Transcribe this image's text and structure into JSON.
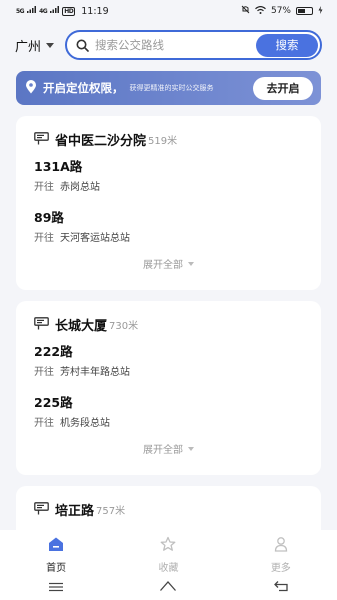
{
  "status_bar": {
    "signal1": "5G",
    "signal2": "4G",
    "hd": "HD",
    "time": "11:19",
    "battery_percent": "57%",
    "battery_level": 0.57
  },
  "search": {
    "city": "广州",
    "placeholder": "搜索公交路线",
    "button_label": "搜索"
  },
  "location_banner": {
    "title": "开启定位权限，",
    "subtitle": "获得更精准的实时公交服务",
    "button_label": "去开启"
  },
  "stops": [
    {
      "name": "省中医二沙分院",
      "distance": "519米",
      "routes": [
        {
          "name": "131A路",
          "prefix": "开往",
          "destination": "赤岗总站"
        },
        {
          "name": "89路",
          "prefix": "开往",
          "destination": "天河客运站总站"
        }
      ],
      "expand_label": "展开全部"
    },
    {
      "name": "长城大厦",
      "distance": "730米",
      "routes": [
        {
          "name": "222路",
          "prefix": "开往",
          "destination": "芳村丰年路总站"
        },
        {
          "name": "225路",
          "prefix": "开往",
          "destination": "机务段总站"
        }
      ],
      "expand_label": "展开全部"
    },
    {
      "name": "培正路",
      "distance": "757米",
      "routes": [],
      "expand_label": ""
    }
  ],
  "tabs": [
    {
      "label": "首页",
      "icon": "home-icon",
      "active": true
    },
    {
      "label": "收藏",
      "icon": "star-icon",
      "active": false
    },
    {
      "label": "更多",
      "icon": "person-icon",
      "active": false
    }
  ],
  "colors": {
    "accent": "#4a72e0",
    "banner": "#6a82cc"
  }
}
